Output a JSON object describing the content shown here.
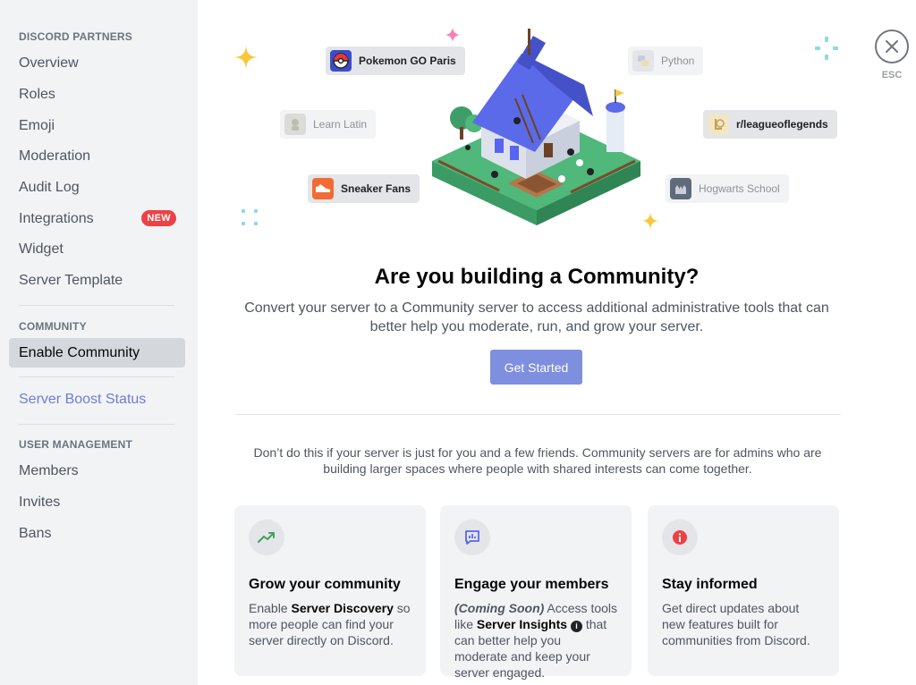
{
  "sidebar": {
    "sections": [
      {
        "header": "DISCORD PARTNERS",
        "items": [
          {
            "label": "Overview"
          },
          {
            "label": "Roles"
          },
          {
            "label": "Emoji"
          },
          {
            "label": "Moderation"
          },
          {
            "label": "Audit Log"
          },
          {
            "label": "Integrations",
            "badge": "NEW"
          },
          {
            "label": "Widget"
          },
          {
            "label": "Server Template"
          }
        ]
      },
      {
        "header": "COMMUNITY",
        "items": [
          {
            "label": "Enable Community",
            "selected": true
          }
        ]
      },
      {
        "header": "",
        "items": [
          {
            "label": "Server Boost Status"
          }
        ]
      },
      {
        "header": "USER MANAGEMENT",
        "items": [
          {
            "label": "Members"
          },
          {
            "label": "Invites"
          },
          {
            "label": "Bans"
          }
        ]
      }
    ]
  },
  "close": {
    "esc_label": "ESC",
    "icon": "close-icon"
  },
  "hero": {
    "servers": [
      {
        "name": "Pokemon GO Paris",
        "icon": "pokeball-icon",
        "highlighted": true
      },
      {
        "name": "Python",
        "icon": "python-icon",
        "highlighted": false
      },
      {
        "name": "Learn Latin",
        "icon": "statue-icon",
        "highlighted": false
      },
      {
        "name": "r/leagueoflegends",
        "icon": "league-icon",
        "highlighted": true
      },
      {
        "name": "Sneaker Fans",
        "icon": "sneaker-icon",
        "highlighted": true
      },
      {
        "name": "Hogwarts School",
        "icon": "hogwarts-icon",
        "highlighted": false
      }
    ]
  },
  "main": {
    "title": "Are you building a Community?",
    "subtitle": "Convert your server to a Community server to access additional administrative tools that can better help you moderate, run, and grow your server.",
    "cta_label": "Get Started",
    "note": "Don’t do this if your server is just for you and a few friends. Community servers are for admins who are building larger spaces where people with shared interests can come together."
  },
  "cards": [
    {
      "title": "Grow your community",
      "icon": "trending-up-icon",
      "body_pre": "Enable ",
      "body_bold": "Server Discovery",
      "body_post": " so more people can find your server directly on Discord."
    },
    {
      "title": "Engage your members",
      "icon": "insights-icon",
      "body_italic": "(Coming Soon)",
      "body_pre": " Access tools like ",
      "body_bold": "Server Insights",
      "body_post": " that can better help you moderate and keep your server engaged."
    },
    {
      "title": "Stay informed",
      "icon": "info-icon",
      "body": "Get direct updates about new features built for communities from Discord."
    }
  ],
  "colors": {
    "accent": "#7d8fde",
    "badge": "#ed4245",
    "boost_link": "#6c7ed6",
    "trend_icon": "#3ba55c",
    "insights_icon": "#5865f2",
    "info_icon": "#ed4245"
  }
}
